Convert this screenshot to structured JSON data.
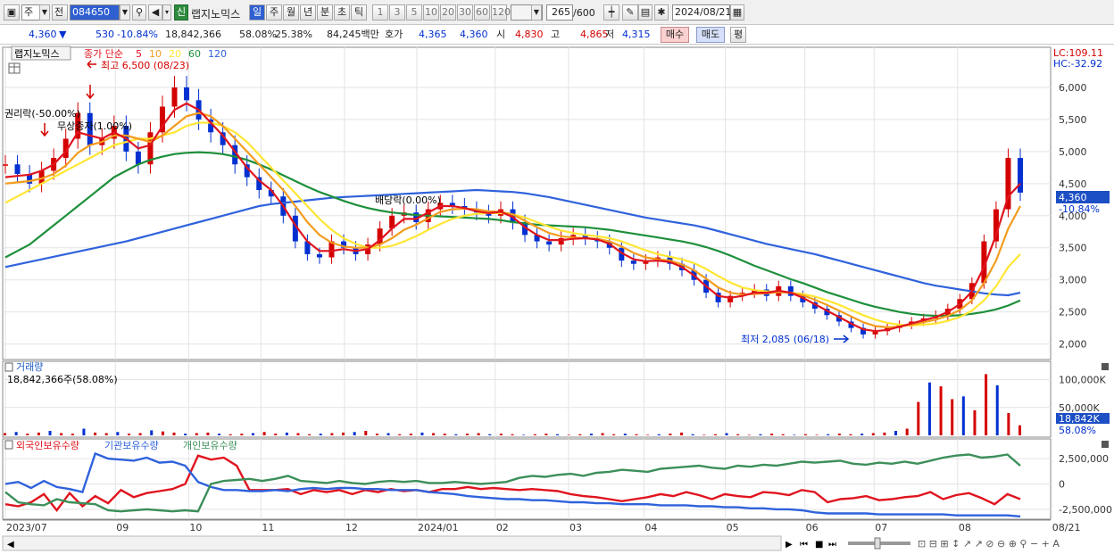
{
  "toolbar": {
    "type1": "주",
    "type2": "전",
    "code": "084650",
    "name": "랩지노믹스",
    "badge": "신",
    "periods": [
      "일",
      "주",
      "월",
      "년",
      "분",
      "초",
      "틱"
    ],
    "minutes": [
      "1",
      "3",
      "5",
      "10",
      "20",
      "30",
      "60",
      "120"
    ],
    "count": "265",
    "count_total": "/600",
    "date": "2024/08/21"
  },
  "quote": {
    "price": "4,360",
    "arrow": "▼",
    "change": "530",
    "change_pct": "-10.84%",
    "volume": "18,842,366",
    "vol_pct": "58.08%",
    "turnover": "25.38%",
    "amount": "84,245백만",
    "hoga_label": "호가",
    "hoga1": "4,365",
    "hoga2": "4,360",
    "open_label": "시",
    "open": "4,830",
    "high_label": "고",
    "high": "4,865",
    "low_label": "저",
    "low": "4,315",
    "buy": "매수",
    "sell": "매도",
    "eval": "평"
  },
  "colors": {
    "up": "#d40000",
    "down": "#0030d0",
    "ma5": "#e0141e",
    "ma10": "#f39c1d",
    "ma20": "#ffe633",
    "ma60": "#1d8f3a",
    "ma120": "#2f62dc",
    "foreign": "#e0141e",
    "inst": "#2f62dc",
    "indiv": "#3c8f5a"
  },
  "price_pane": {
    "title": "랩지노믹스",
    "legend_label": "종가 단순",
    "ma_labels": [
      "5",
      "10",
      "20",
      "60",
      "120"
    ],
    "lc": "LC:109.11",
    "hc": "HC:-32.92",
    "current_price": "4,360",
    "current_pct": "-10.84%",
    "annotations": {
      "high": "최고 6,500 (08/23)",
      "low": "최저 2,085 (06/18)",
      "rights": "권리락(-50.00%)",
      "bonus": "무상증자(1.00%)",
      "dividend": "배당락(0.00%)"
    }
  },
  "volume_pane": {
    "title": "거래량",
    "value": "18,842,366주(58.08%)",
    "current": "18,842K",
    "current_pct": "58.08%"
  },
  "holdings_pane": {
    "legend": [
      "외국인보유수량",
      "기관보유수량",
      "개인보유수량"
    ]
  },
  "x_axis": {
    "labels": [
      "2023/07",
      "09",
      "10",
      "11",
      "12",
      "2024/01",
      "02",
      "03",
      "04",
      "05",
      "06",
      "07",
      "08",
      "08/21"
    ]
  },
  "chart_data": [
    {
      "type": "line",
      "title": "랩지노믹스",
      "series": [
        {
          "name": "종가",
          "values": [
            4800,
            4650,
            4500,
            4700,
            4900,
            5200,
            5600,
            5100,
            5200,
            5400,
            5000,
            4800,
            5300,
            5700,
            6000,
            5800,
            5500,
            5300,
            5100,
            4800,
            4600,
            4400,
            4300,
            4000,
            3600,
            3400,
            3350,
            3600,
            3500,
            3400,
            3550,
            3800,
            4000,
            4050,
            3900,
            4100,
            4200,
            4150,
            4100,
            4050,
            4000,
            4100,
            3900,
            3700,
            3600,
            3550,
            3650,
            3700,
            3650,
            3600,
            3500,
            3300,
            3250,
            3300,
            3350,
            3250,
            3150,
            3000,
            2800,
            2650,
            2750,
            2800,
            2850,
            2750,
            2900,
            2750,
            2650,
            2550,
            2450,
            2350,
            2250,
            2150,
            2200,
            2250,
            2300,
            2350,
            2400,
            2450,
            2550,
            2700,
            2950,
            3600,
            4100,
            4900,
            4360
          ]
        },
        {
          "name": "5",
          "values": [
            4600,
            4620,
            4640,
            4700,
            4800,
            5000,
            5300,
            5250,
            5200,
            5300,
            5200,
            5050,
            5100,
            5400,
            5650,
            5750,
            5650,
            5450,
            5250,
            5000,
            4750,
            4550,
            4400,
            4150,
            3850,
            3600,
            3450,
            3450,
            3480,
            3450,
            3480,
            3620,
            3800,
            3950,
            3950,
            4050,
            4150,
            4150,
            4120,
            4070,
            4040,
            4060,
            3980,
            3820,
            3700,
            3620,
            3620,
            3640,
            3650,
            3630,
            3560,
            3420,
            3320,
            3290,
            3300,
            3280,
            3200,
            3070,
            2900,
            2750,
            2720,
            2750,
            2800,
            2800,
            2830,
            2800,
            2720,
            2620,
            2520,
            2420,
            2320,
            2230,
            2200,
            2220,
            2270,
            2320,
            2370,
            2420,
            2500,
            2620,
            2820,
            3200,
            3700,
            4300,
            4500
          ]
        },
        {
          "name": "10",
          "values": [
            4500,
            4520,
            4540,
            4580,
            4650,
            4780,
            4980,
            5100,
            5150,
            5250,
            5250,
            5200,
            5150,
            5250,
            5400,
            5550,
            5600,
            5550,
            5400,
            5200,
            5000,
            4800,
            4600,
            4400,
            4150,
            3900,
            3700,
            3580,
            3520,
            3500,
            3500,
            3550,
            3650,
            3780,
            3860,
            3960,
            4060,
            4100,
            4110,
            4100,
            4070,
            4060,
            4020,
            3920,
            3820,
            3730,
            3680,
            3660,
            3650,
            3640,
            3600,
            3520,
            3420,
            3350,
            3320,
            3300,
            3240,
            3150,
            3020,
            2880,
            2800,
            2770,
            2780,
            2790,
            2810,
            2800,
            2760,
            2690,
            2610,
            2520,
            2430,
            2340,
            2280,
            2260,
            2270,
            2300,
            2340,
            2380,
            2440,
            2530,
            2680,
            2950,
            3300,
            3800,
            4150
          ]
        },
        {
          "name": "20",
          "values": [
            4200,
            4300,
            4400,
            4500,
            4600,
            4700,
            4800,
            4900,
            5000,
            5100,
            5150,
            5200,
            5200,
            5250,
            5300,
            5400,
            5450,
            5450,
            5400,
            5300,
            5150,
            4950,
            4750,
            4550,
            4350,
            4150,
            3950,
            3780,
            3650,
            3560,
            3500,
            3500,
            3530,
            3600,
            3680,
            3780,
            3870,
            3950,
            4000,
            4030,
            4040,
            4040,
            4020,
            3970,
            3900,
            3830,
            3770,
            3730,
            3700,
            3680,
            3650,
            3600,
            3530,
            3460,
            3400,
            3360,
            3320,
            3260,
            3170,
            3060,
            2960,
            2880,
            2840,
            2820,
            2810,
            2800,
            2780,
            2740,
            2680,
            2610,
            2530,
            2450,
            2380,
            2330,
            2300,
            2290,
            2300,
            2320,
            2360,
            2420,
            2520,
            2680,
            2900,
            3200,
            3400
          ]
        },
        {
          "name": "60",
          "values": [
            3350,
            3450,
            3550,
            3700,
            3850,
            4000,
            4150,
            4300,
            4450,
            4600,
            4700,
            4800,
            4870,
            4920,
            4960,
            4980,
            4990,
            4980,
            4960,
            4920,
            4870,
            4800,
            4720,
            4630,
            4540,
            4450,
            4370,
            4300,
            4230,
            4170,
            4120,
            4080,
            4050,
            4030,
            4010,
            4000,
            3990,
            3980,
            3970,
            3960,
            3950,
            3930,
            3900,
            3880,
            3860,
            3850,
            3840,
            3830,
            3820,
            3800,
            3780,
            3750,
            3720,
            3690,
            3660,
            3630,
            3600,
            3560,
            3510,
            3450,
            3380,
            3300,
            3220,
            3150,
            3080,
            3010,
            2950,
            2880,
            2810,
            2750,
            2690,
            2630,
            2580,
            2540,
            2500,
            2470,
            2450,
            2440,
            2440,
            2450,
            2470,
            2500,
            2540,
            2600,
            2680
          ]
        },
        {
          "name": "120",
          "values": [
            3200,
            3240,
            3280,
            3320,
            3360,
            3400,
            3440,
            3480,
            3520,
            3560,
            3600,
            3650,
            3700,
            3750,
            3800,
            3850,
            3900,
            3950,
            4000,
            4050,
            4100,
            4150,
            4180,
            4200,
            4220,
            4240,
            4260,
            4280,
            4290,
            4300,
            4310,
            4320,
            4330,
            4340,
            4350,
            4360,
            4370,
            4380,
            4390,
            4400,
            4390,
            4380,
            4370,
            4350,
            4320,
            4290,
            4250,
            4210,
            4170,
            4130,
            4090,
            4050,
            4010,
            3970,
            3940,
            3910,
            3880,
            3850,
            3810,
            3760,
            3710,
            3660,
            3610,
            3560,
            3520,
            3480,
            3440,
            3400,
            3350,
            3300,
            3250,
            3200,
            3150,
            3100,
            3050,
            3000,
            2950,
            2910,
            2880,
            2850,
            2820,
            2790,
            2770,
            2760,
            2800
          ]
        }
      ],
      "ylim": [
        1800,
        6500
      ],
      "y_ticks": [
        "6,000",
        "5,500",
        "5,000",
        "4,500",
        "4,000",
        "3,500",
        "3,000",
        "2,500",
        "2,000"
      ]
    },
    {
      "type": "bar",
      "title": "거래량",
      "values": [
        4,
        6,
        3,
        5,
        8,
        4,
        3,
        12,
        5,
        4,
        6,
        3,
        4,
        9,
        7,
        5,
        3,
        4,
        5,
        3,
        2,
        3,
        4,
        6,
        3,
        5,
        4,
        2,
        3,
        4,
        5,
        6,
        8,
        3,
        4,
        2,
        3,
        5,
        4,
        3,
        2,
        3,
        4,
        2,
        3,
        2,
        1,
        2,
        3,
        2,
        1,
        2,
        3,
        4,
        2,
        3,
        2,
        1,
        2,
        3,
        5,
        2,
        1,
        2,
        4,
        2,
        1,
        2,
        3,
        2,
        1,
        2,
        1,
        2,
        3,
        2,
        3,
        4,
        5,
        8,
        12,
        60,
        95,
        88,
        65,
        70,
        45,
        110,
        90,
        40,
        18
      ],
      "y_ticks": [
        "100,000K",
        "50,000K"
      ]
    },
    {
      "type": "line",
      "title": "보유수량",
      "series": [
        {
          "name": "외국인보유수량",
          "values": [
            -2000000,
            -2200000,
            -1800000,
            -1000000,
            -2600000,
            -900000,
            -2200000,
            -1200000,
            -1900000,
            -600000,
            -1300000,
            -900000,
            -700000,
            -500000,
            0,
            2800000,
            2400000,
            2600000,
            1800000,
            -600000,
            -600000,
            -600000,
            -500000,
            -1000000,
            -600000,
            -800000,
            -600000,
            -1000000,
            -600000,
            -800000,
            -500000,
            -700000,
            -600000,
            -800000,
            -500000,
            -500000,
            -300000,
            -500000,
            -400000,
            -500000,
            -600000,
            -500000,
            -600000,
            -700000,
            -1000000,
            -1200000,
            -1300000,
            -1500000,
            -1700000,
            -1500000,
            -1300000,
            -1000000,
            -1200000,
            -800000,
            -1100000,
            -1500000,
            -1000000,
            -1200000,
            -1300000,
            -800000,
            -900000,
            -1100000,
            -600000,
            -800000,
            -1800000,
            -1500000,
            -1400000,
            -1200000,
            -1600000,
            -1500000,
            -1300000,
            -1200000,
            -800000,
            -1500000,
            -1100000,
            -900000,
            -1400000,
            -2000000,
            -1000000,
            -1500000
          ]
        },
        {
          "name": "기관보유수량",
          "values": [
            0,
            200000,
            -400000,
            300000,
            -300000,
            -500000,
            -800000,
            3000000,
            2500000,
            2400000,
            2300000,
            2600000,
            2100000,
            2200000,
            1800000,
            200000,
            -300000,
            -600000,
            -600000,
            -700000,
            -700000,
            -600000,
            -700000,
            -500000,
            -400000,
            -500000,
            -400000,
            -400000,
            -500000,
            -500000,
            -600000,
            -600000,
            -600000,
            -800000,
            -900000,
            -1000000,
            -1200000,
            -1300000,
            -1400000,
            -1500000,
            -1500000,
            -1600000,
            -1600000,
            -1700000,
            -1800000,
            -1800000,
            -1900000,
            -1900000,
            -2000000,
            -2000000,
            -2000000,
            -2100000,
            -2100000,
            -2100000,
            -2200000,
            -2200000,
            -2300000,
            -2300000,
            -2400000,
            -2400000,
            -2500000,
            -2500000,
            -2600000,
            -2800000,
            -2900000,
            -2900000,
            -2900000,
            -2900000,
            -3000000,
            -3000000,
            -3000000,
            -3000000,
            -3000000,
            -3000000,
            -3100000,
            -3100000,
            -3100000,
            -3100000,
            -3100000,
            -3200000
          ]
        },
        {
          "name": "개인보유수량",
          "values": [
            -800000,
            -1800000,
            -2000000,
            -2100000,
            -1500000,
            -1800000,
            -1900000,
            -2000000,
            -2600000,
            -2700000,
            -2600000,
            -2500000,
            -2600000,
            -2700000,
            -2600000,
            -2700000,
            0,
            300000,
            400000,
            500000,
            300000,
            500000,
            800000,
            300000,
            200000,
            100000,
            300000,
            100000,
            0,
            200000,
            300000,
            200000,
            300000,
            100000,
            100000,
            200000,
            100000,
            0,
            100000,
            200000,
            600000,
            800000,
            700000,
            900000,
            1000000,
            800000,
            1100000,
            1200000,
            1400000,
            1300000,
            1200000,
            1500000,
            1600000,
            1700000,
            1800000,
            1600000,
            1500000,
            1800000,
            1700000,
            1900000,
            1800000,
            2000000,
            2200000,
            2100000,
            2200000,
            2300000,
            2000000,
            1900000,
            2100000,
            2000000,
            2200000,
            2000000,
            2300000,
            2600000,
            2800000,
            2900000,
            2600000,
            2700000,
            2900000,
            1800000
          ]
        }
      ],
      "y_ticks": [
        "2,500,000",
        "0",
        "-2,500,000"
      ]
    }
  ]
}
